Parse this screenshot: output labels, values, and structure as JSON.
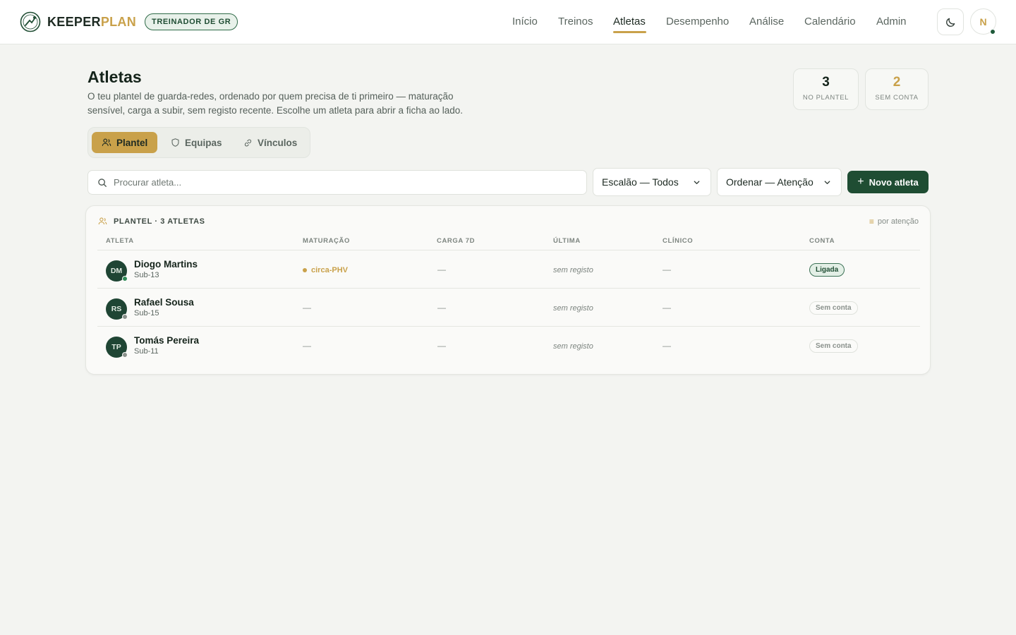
{
  "app": {
    "brand_a": "KEEPER",
    "brand_b": "PLAN",
    "role": "TREINADOR DE GR"
  },
  "nav": {
    "items": [
      {
        "label": "Início"
      },
      {
        "label": "Treinos"
      },
      {
        "label": "Atletas"
      },
      {
        "label": "Desempenho"
      },
      {
        "label": "Análise"
      },
      {
        "label": "Calendário"
      },
      {
        "label": "Admin"
      }
    ],
    "active": "Atletas"
  },
  "user": {
    "initial": "N"
  },
  "page": {
    "title": "Atletas",
    "description": "O teu plantel de guarda-redes, ordenado por quem precisa de ti primeiro — maturação sensível, carga a subir, sem registo recente. Escolhe um atleta para abrir a ficha ao lado."
  },
  "stats": [
    {
      "value": "3",
      "label": "NO PLANTEL",
      "color": "#15241b"
    },
    {
      "value": "2",
      "label": "SEM CONTA",
      "color": "#c9a14a"
    }
  ],
  "tabs": [
    {
      "label": "Plantel",
      "icon": "users-icon"
    },
    {
      "label": "Equipas",
      "icon": "shield-icon"
    },
    {
      "label": "Vínculos",
      "icon": "link-icon"
    }
  ],
  "filters": {
    "search_placeholder": "Procurar atleta...",
    "escalao": "Escalão — Todos",
    "ordenar": "Ordenar — Atenção",
    "new_button": "Novo atleta"
  },
  "table": {
    "title": "PLANTEL · 3 ATLETAS",
    "sort_hint": "por atenção",
    "columns": [
      "ATLETA",
      "MATURAÇÃO",
      "CARGA 7D",
      "ÚLTIMA",
      "CLÍNICO",
      "CONTA"
    ],
    "rows": [
      {
        "initials": "DM",
        "name": "Diogo Martins",
        "team": "Sub-13",
        "maturacao": "circa-PHV",
        "carga": "—",
        "ultima": "sem registo",
        "clinico": "—",
        "conta": "Ligada",
        "status_color": "#2e8b57"
      },
      {
        "initials": "RS",
        "name": "Rafael Sousa",
        "team": "Sub-15",
        "maturacao": "—",
        "carga": "—",
        "ultima": "sem registo",
        "clinico": "—",
        "conta": "Sem conta",
        "status_color": "#8a918c"
      },
      {
        "initials": "TP",
        "name": "Tomás Pereira",
        "team": "Sub-11",
        "maturacao": "—",
        "carga": "—",
        "ultima": "sem registo",
        "clinico": "—",
        "conta": "Sem conta",
        "status_color": "#8a918c"
      }
    ]
  },
  "colors": {
    "accent_gold": "#c9a14a",
    "brand_green": "#1f4d33",
    "background": "#f3f4f1"
  }
}
